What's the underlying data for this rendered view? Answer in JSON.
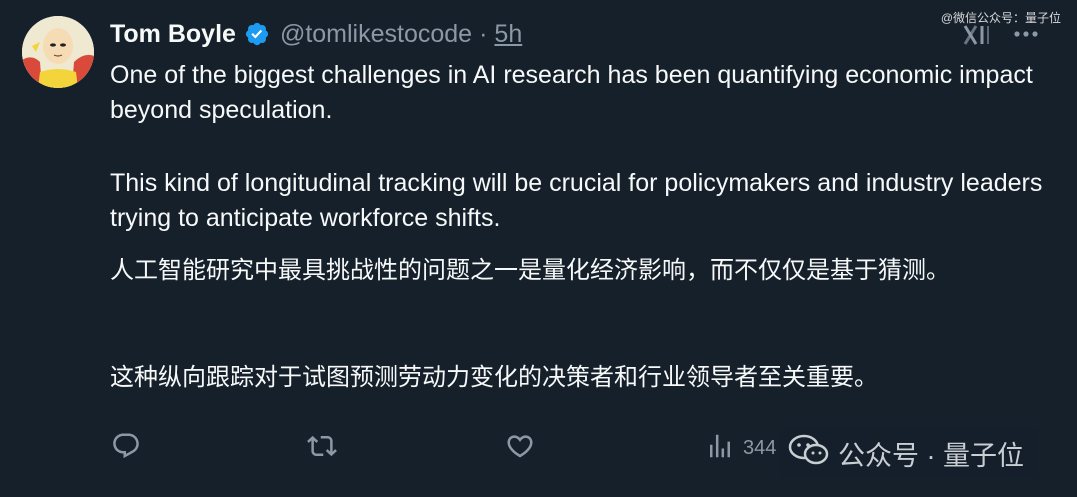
{
  "header": {
    "display_name": "Tom Boyle",
    "handle": "@tomlikestocode",
    "separator": "·",
    "time": "5h"
  },
  "body": {
    "en_paragraph_1": "One of the biggest challenges in AI research has been quantifying economic impact beyond speculation.",
    "en_paragraph_2": "This kind of longitudinal tracking will be crucial for policymakers and industry leaders trying to anticipate workforce shifts.",
    "zh_paragraph_1": "人工智能研究中最具挑战性的问题之一是量化经济影响，而不仅仅是基于猜测。",
    "zh_paragraph_2": "这种纵向跟踪对于试图预测劳动力变化的决策者和行业领导者至关重要。"
  },
  "actions": {
    "views_count": "344"
  },
  "watermark": {
    "top_right": "@微信公众号：量子位",
    "overlay_text": "公众号 · 量子位"
  },
  "icons": {
    "verified": "verified-badge-icon",
    "grok": "grok-icon",
    "more": "more-icon",
    "reply": "reply-icon",
    "retweet": "retweet-icon",
    "like": "like-icon",
    "views": "views-icon",
    "wechat": "wechat-icon"
  },
  "colors": {
    "background": "#15202b",
    "text_primary": "#f7f9f9",
    "text_secondary": "#8b98a5",
    "verified_blue": "#1d9bf0"
  }
}
